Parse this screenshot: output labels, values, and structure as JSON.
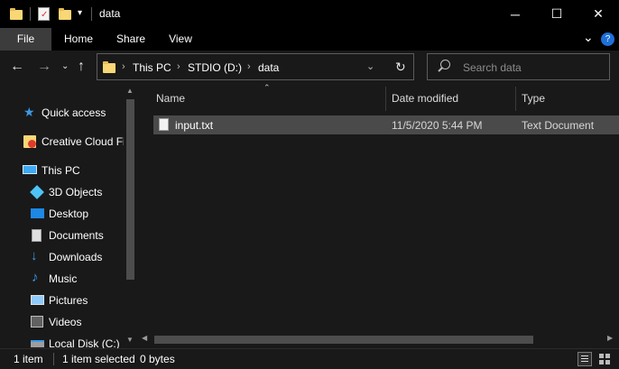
{
  "window": {
    "title": "data",
    "minimize": "─",
    "maximize": "☐",
    "close": "✕"
  },
  "ribbon": {
    "tabs": [
      "File",
      "Home",
      "Share",
      "View"
    ],
    "collapse": "⌄",
    "help": "?"
  },
  "address": {
    "crumbs": [
      "This PC",
      "STDIO (D:)",
      "data"
    ],
    "refresh": "↻"
  },
  "search": {
    "placeholder": "Search data"
  },
  "nav": {
    "items": [
      {
        "label": "Quick access",
        "icon": "star-icon"
      },
      {
        "label": "Creative Cloud Fi",
        "icon": "creative-cloud-icon"
      },
      {
        "label": "This PC",
        "icon": "computer-icon"
      },
      {
        "label": "3D Objects",
        "icon": "cube-icon"
      },
      {
        "label": "Desktop",
        "icon": "desktop-icon"
      },
      {
        "label": "Documents",
        "icon": "documents-icon"
      },
      {
        "label": "Downloads",
        "icon": "download-icon"
      },
      {
        "label": "Music",
        "icon": "music-icon"
      },
      {
        "label": "Pictures",
        "icon": "pictures-icon"
      },
      {
        "label": "Videos",
        "icon": "videos-icon"
      },
      {
        "label": "Local Disk (C:)",
        "icon": "drive-icon"
      }
    ]
  },
  "columns": {
    "name": "Name",
    "date": "Date modified",
    "type": "Type"
  },
  "files": [
    {
      "name": "input.txt",
      "date": "11/5/2020 5:44 PM",
      "type": "Text Document"
    }
  ],
  "status": {
    "count": "1 item",
    "selected": "1 item selected",
    "size": "0 bytes"
  },
  "colors": {
    "background": "#191919",
    "chrome": "#000000",
    "selection": "#4a4a4a",
    "folder": "#f8d775"
  }
}
